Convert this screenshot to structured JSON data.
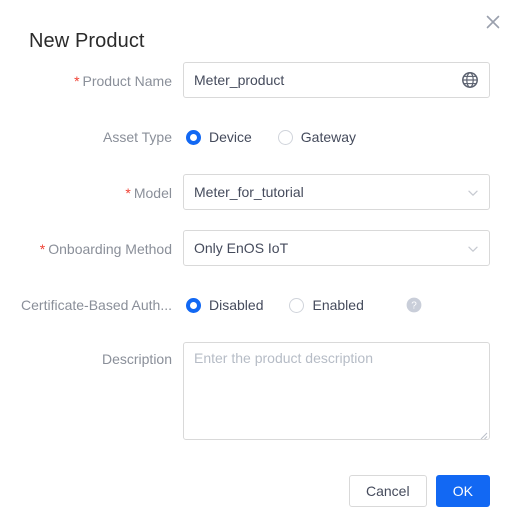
{
  "dialog": {
    "title": "New Product",
    "close_icon": "close-icon"
  },
  "form": {
    "product_name": {
      "label": "Product Name",
      "required": true,
      "value": "Meter_product",
      "placeholder": "",
      "trailing_icon": "globe-icon"
    },
    "asset_type": {
      "label": "Asset Type",
      "required": false,
      "selected": "Device",
      "options": [
        "Device",
        "Gateway"
      ]
    },
    "model": {
      "label": "Model",
      "required": true,
      "value": "Meter_for_tutorial",
      "trailing_icon": "chevron-down-icon"
    },
    "onboarding_method": {
      "label": "Onboarding Method",
      "required": true,
      "value": "Only EnOS IoT",
      "trailing_icon": "chevron-down-icon"
    },
    "certificate_auth": {
      "label": "Certificate-Based Auth...",
      "required": false,
      "selected": "Disabled",
      "options": [
        "Disabled",
        "Enabled"
      ],
      "help_icon": "question-circle-icon"
    },
    "description": {
      "label": "Description",
      "required": false,
      "value": "",
      "placeholder": "Enter the product description"
    }
  },
  "footer": {
    "cancel_label": "Cancel",
    "ok_label": "OK"
  },
  "colors": {
    "primary": "#1268f3",
    "required_star": "#f04134",
    "label_text": "#8a8f99",
    "value_text": "#454b5c",
    "border": "#d9d9d9",
    "placeholder": "#b6bcc6"
  }
}
